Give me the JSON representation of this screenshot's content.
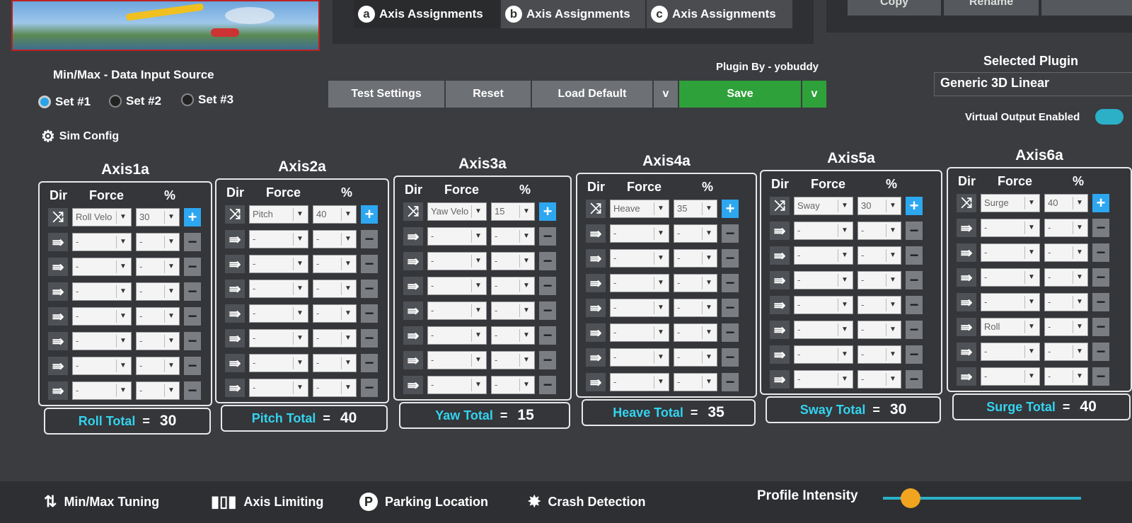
{
  "tabs": [
    {
      "letter": "a",
      "label": "Axis Assignments"
    },
    {
      "letter": "b",
      "label": "Axis Assignments"
    },
    {
      "letter": "c",
      "label": "Axis Assignments"
    }
  ],
  "top_right_buttons": [
    "Copy",
    "Rename"
  ],
  "minmax": {
    "label": "Min/Max - Data Input Source",
    "options": [
      "Set #1",
      "Set #2",
      "Set #3"
    ],
    "selected": "Set #1"
  },
  "sim_config": "Sim Config",
  "plugin_by": "Plugin By - yobuddy",
  "buttons": {
    "test": "Test Settings",
    "reset": "Reset",
    "load_default": "Load Default",
    "dropdown": "v",
    "save": "Save",
    "save_dropdown": "v"
  },
  "selected_plugin": {
    "label": "Selected Plugin",
    "value": "Generic 3D Linear"
  },
  "virtual_output": "Virtual Output Enabled",
  "headers": {
    "dir": "Dir",
    "force": "Force",
    "pct": "%"
  },
  "axes": [
    {
      "title": "Axis1a",
      "rows": [
        [
          "Roll Velo",
          "30"
        ],
        [
          "-",
          "-"
        ],
        [
          "-",
          "-"
        ],
        [
          "-",
          "-"
        ],
        [
          "-",
          "-"
        ],
        [
          "-",
          "-"
        ],
        [
          "-",
          "-"
        ],
        [
          "-",
          "-"
        ]
      ],
      "total_label": "Roll Total",
      "total": "30"
    },
    {
      "title": "Axis2a",
      "rows": [
        [
          "Pitch",
          "40"
        ],
        [
          "-",
          "-"
        ],
        [
          "-",
          "-"
        ],
        [
          "-",
          "-"
        ],
        [
          "-",
          "-"
        ],
        [
          "-",
          "-"
        ],
        [
          "-",
          "-"
        ],
        [
          "-",
          "-"
        ]
      ],
      "total_label": "Pitch Total",
      "total": "40"
    },
    {
      "title": "Axis3a",
      "rows": [
        [
          "Yaw Velo",
          "15"
        ],
        [
          "-",
          "-"
        ],
        [
          "-",
          "-"
        ],
        [
          "-",
          "-"
        ],
        [
          "-",
          "-"
        ],
        [
          "-",
          "-"
        ],
        [
          "-",
          "-"
        ],
        [
          "-",
          "-"
        ]
      ],
      "total_label": "Yaw Total",
      "total": "15"
    },
    {
      "title": "Axis4a",
      "rows": [
        [
          "Heave",
          "35"
        ],
        [
          "-",
          "-"
        ],
        [
          "-",
          "-"
        ],
        [
          "-",
          "-"
        ],
        [
          "-",
          "-"
        ],
        [
          "-",
          "-"
        ],
        [
          "-",
          "-"
        ],
        [
          "-",
          "-"
        ]
      ],
      "total_label": "Heave Total",
      "total": "35"
    },
    {
      "title": "Axis5a",
      "rows": [
        [
          "Sway",
          "30"
        ],
        [
          "-",
          "-"
        ],
        [
          "-",
          "-"
        ],
        [
          "-",
          "-"
        ],
        [
          "-",
          "-"
        ],
        [
          "-",
          "-"
        ],
        [
          "-",
          "-"
        ],
        [
          "-",
          "-"
        ]
      ],
      "total_label": "Sway Total",
      "total": "30"
    },
    {
      "title": "Axis6a",
      "rows": [
        [
          "Surge",
          "40"
        ],
        [
          "-",
          "-"
        ],
        [
          "-",
          "-"
        ],
        [
          "-",
          "-"
        ],
        [
          "-",
          "-"
        ],
        [
          "Roll",
          "-"
        ],
        [
          "-",
          "-"
        ],
        [
          "-",
          "-"
        ]
      ],
      "total_label": "Surge Total",
      "total": "40"
    }
  ],
  "total_eq": "=",
  "bottom": {
    "minmax": "Min/Max Tuning",
    "limiting": "Axis Limiting",
    "parking": "Parking Location",
    "crash": "Crash Detection",
    "intensity": "Profile Intensity"
  },
  "parking_icon_letter": "P",
  "intensity_fraction": 0.14,
  "icons": {
    "shuffle": "⤨",
    "arrow": "⇛",
    "gear": "⚙",
    "plus": "+",
    "minus": "−",
    "chevron": "▼"
  }
}
